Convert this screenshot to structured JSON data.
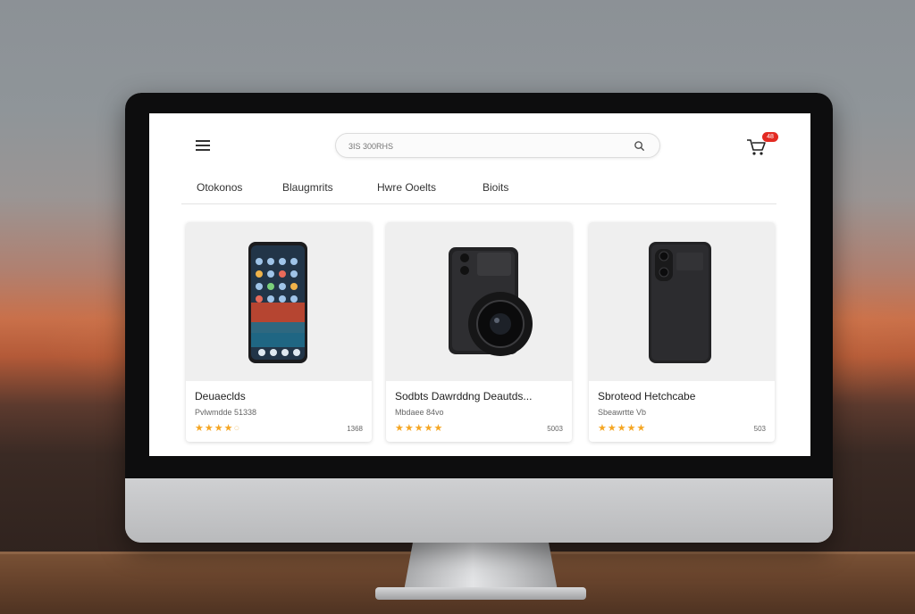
{
  "search": {
    "placeholder": "3IS 300RHS"
  },
  "cart": {
    "badge": "48"
  },
  "nav": {
    "tabs": [
      "Otokonos",
      "Blaugmrits",
      "Hwre Ooelts",
      "Bioits"
    ]
  },
  "products": [
    {
      "title": "Deuaeclds",
      "subtitle": "Pvlwmdde 51338",
      "rating": 4,
      "rating_max": 5,
      "price": "1368",
      "image": "smartphone-icon"
    },
    {
      "title": "Sodbts Dawrddng Deautds...",
      "subtitle": "Mbdaee 84vo",
      "rating": 5,
      "rating_max": 5,
      "price": "5003",
      "image": "camera-icon"
    },
    {
      "title": "Sbroteod Hetchcabe",
      "subtitle": "Sbeawrtte Vb",
      "rating": 5,
      "rating_max": 5,
      "price": "503",
      "image": "phone-back-icon"
    }
  ],
  "colors": {
    "accent": "#e32a22",
    "star": "#f5a623"
  }
}
